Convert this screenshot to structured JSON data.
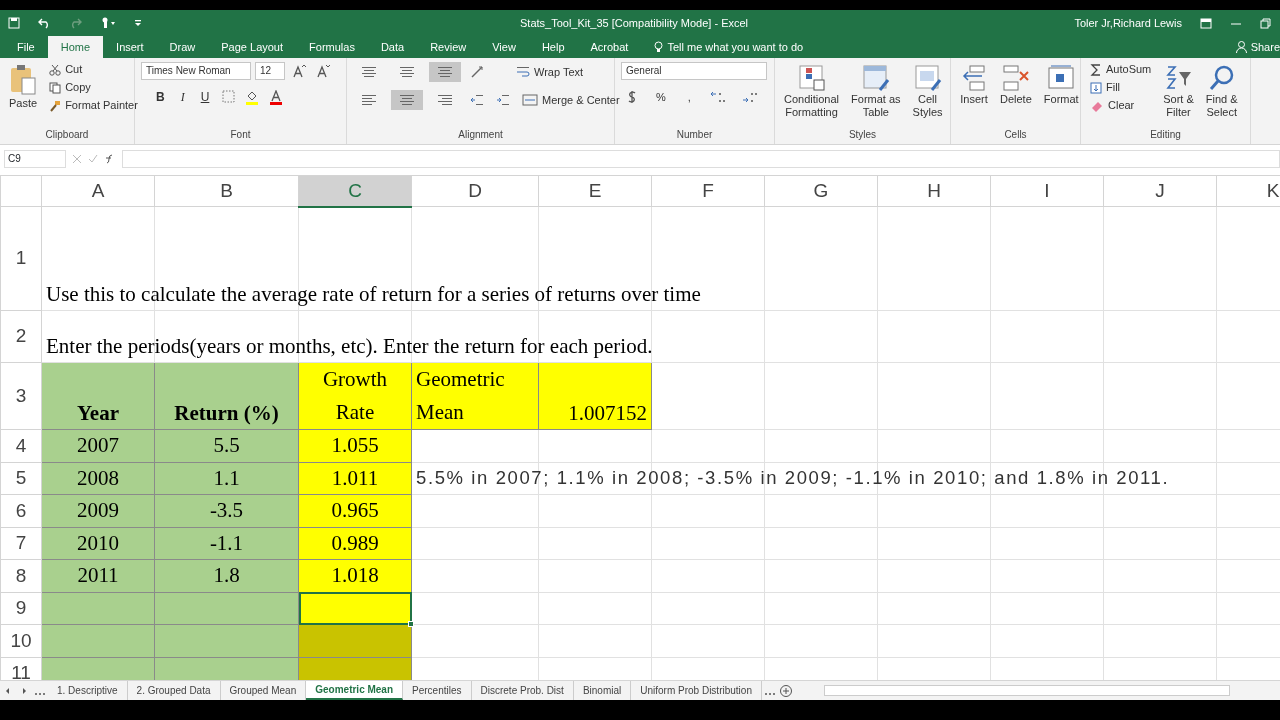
{
  "title_bar": {
    "title": "Stats_Tool_Kit_35  [Compatibility Mode]  -  Excel",
    "user": "Toler Jr,Richard Lewis"
  },
  "ribbon_tabs": [
    {
      "label": "File",
      "selected": false
    },
    {
      "label": "Home",
      "selected": true
    },
    {
      "label": "Insert",
      "selected": false
    },
    {
      "label": "Draw",
      "selected": false
    },
    {
      "label": "Page Layout",
      "selected": false
    },
    {
      "label": "Formulas",
      "selected": false
    },
    {
      "label": "Data",
      "selected": false
    },
    {
      "label": "Review",
      "selected": false
    },
    {
      "label": "View",
      "selected": false
    },
    {
      "label": "Help",
      "selected": false
    },
    {
      "label": "Acrobat",
      "selected": false
    }
  ],
  "tell_me": "Tell me what you want to do",
  "share": "Share",
  "clipboard": {
    "paste": "Paste",
    "cut": "Cut",
    "copy": "Copy",
    "format_painter": "Format Painter",
    "label": "Clipboard"
  },
  "font": {
    "name": "Times New Roman",
    "size": "12",
    "format_buttons": [
      "B",
      "I",
      "U"
    ],
    "label": "Font"
  },
  "alignment": {
    "vertical": [
      {
        "selected": false
      },
      {
        "selected": false
      },
      {
        "selected": true
      }
    ],
    "horizontal": [
      {
        "selected": false
      },
      {
        "selected": true
      },
      {
        "selected": false
      }
    ],
    "wrap_text": "Wrap Text",
    "merge_center": "Merge & Center",
    "label": "Alignment"
  },
  "number": {
    "format": "General",
    "percent": "%",
    "comma": ",",
    "label": "Number"
  },
  "styles": {
    "buttons": [
      [
        "Conditional",
        "Formatting"
      ],
      [
        "Format as",
        "Table"
      ],
      [
        "Cell",
        "Styles"
      ]
    ],
    "label": "Styles"
  },
  "cells": {
    "buttons": [
      "Insert",
      "Delete",
      "Format"
    ],
    "label": "Cells"
  },
  "editing": {
    "autosum": "AutoSum",
    "fill": "Fill",
    "clear": "Clear",
    "sort_filter": [
      "Sort &",
      "Filter"
    ],
    "find_select": [
      "Find &",
      "Select"
    ],
    "label": "Editing"
  },
  "formula_bar": {
    "name_box": "C9"
  },
  "columns": [
    {
      "label": "A",
      "selected": false
    },
    {
      "label": "B",
      "selected": false
    },
    {
      "label": "C",
      "selected": true
    },
    {
      "label": "D",
      "selected": false
    },
    {
      "label": "E",
      "selected": false
    },
    {
      "label": "F",
      "selected": false
    },
    {
      "label": "G",
      "selected": false
    },
    {
      "label": "H",
      "selected": false
    },
    {
      "label": "I",
      "selected": false
    },
    {
      "label": "J",
      "selected": false
    },
    {
      "label": "K",
      "selected": false
    }
  ],
  "rows": [
    {
      "header": "1",
      "cells": [
        {
          "kind": "title",
          "text": "Use this to calculate the average rate of return for a series of returns over time"
        }
      ]
    },
    {
      "header": "2",
      "cells": [
        {
          "kind": "title",
          "text": "Enter the periods(years or months, etc). Enter the return for each period."
        }
      ]
    },
    {
      "header": "3",
      "cells": [
        {
          "kind": "header",
          "text": "Year",
          "color": "#a9d08e"
        },
        {
          "kind": "header",
          "text": "Return (%)",
          "color": "#a9d08e"
        },
        {
          "kind": "center",
          "text": "Growth\nRate",
          "color": "#ffff00"
        },
        {
          "kind": "label",
          "text": "Geometric\nMean",
          "color": "#ffff00"
        },
        {
          "kind": "value",
          "text": "1.007152",
          "color": "#ffff00"
        }
      ]
    },
    {
      "header": "4",
      "cells": [
        {
          "kind": "center",
          "text": "2007",
          "color": "#a9d08e"
        },
        {
          "kind": "center",
          "text": "5.5",
          "color": "#a9d08e"
        },
        {
          "kind": "center",
          "text": "1.055",
          "color": "#ffff00"
        }
      ]
    },
    {
      "header": "5",
      "cells": [
        {
          "kind": "center",
          "text": "2008",
          "color": "#a9d08e"
        },
        {
          "kind": "center",
          "text": "1.1",
          "color": "#a9d08e"
        },
        {
          "kind": "center",
          "text": "1.011",
          "color": "#ffff00"
        },
        {
          "kind": "note",
          "text": "5.5% in 2007; 1.1% in 2008; -3.5% in 2009; -1.1% in 2010; and 1.8% in 2011."
        }
      ]
    },
    {
      "header": "6",
      "cells": [
        {
          "kind": "center",
          "text": "2009",
          "color": "#a9d08e"
        },
        {
          "kind": "center",
          "text": "-3.5",
          "color": "#a9d08e"
        },
        {
          "kind": "center",
          "text": "0.965",
          "color": "#ffff00"
        }
      ]
    },
    {
      "header": "7",
      "cells": [
        {
          "kind": "center",
          "text": "2010",
          "color": "#a9d08e"
        },
        {
          "kind": "center",
          "text": "-1.1",
          "color": "#a9d08e"
        },
        {
          "kind": "center",
          "text": "0.989",
          "color": "#ffff00"
        }
      ]
    },
    {
      "header": "8",
      "cells": [
        {
          "kind": "center",
          "text": "2011",
          "color": "#a9d08e"
        },
        {
          "kind": "center",
          "text": "1.8",
          "color": "#a9d08e"
        },
        {
          "kind": "center",
          "text": "1.018",
          "color": "#ffff00"
        }
      ]
    },
    {
      "header": "9",
      "cells": [
        {
          "color": "#a9d08e"
        },
        {
          "color": "#a9d08e"
        },
        {
          "color": "#ffff00",
          "selected": true
        }
      ]
    },
    {
      "header": "10",
      "cells": [
        {
          "color": "#a9d08e"
        },
        {
          "color": "#a9d08e"
        },
        {
          "color": "#c9c300"
        }
      ]
    },
    {
      "header": "11",
      "cells": [
        {
          "color": "#a9d08e"
        },
        {
          "color": "#a9d08e"
        },
        {
          "color": "#c9c300"
        }
      ]
    }
  ],
  "sheet_tabs": [
    {
      "label": "1. Descriptive",
      "selected": false
    },
    {
      "label": "2. Grouped Data",
      "selected": false
    },
    {
      "label": "Grouped Mean",
      "selected": false
    },
    {
      "label": "Geometric Mean",
      "selected": true
    },
    {
      "label": "Percentiles",
      "selected": false
    },
    {
      "label": "Discrete Prob. Dist",
      "selected": false
    },
    {
      "label": "Binomial",
      "selected": false
    },
    {
      "label": "Uniform Prob Distribution",
      "selected": false
    }
  ]
}
